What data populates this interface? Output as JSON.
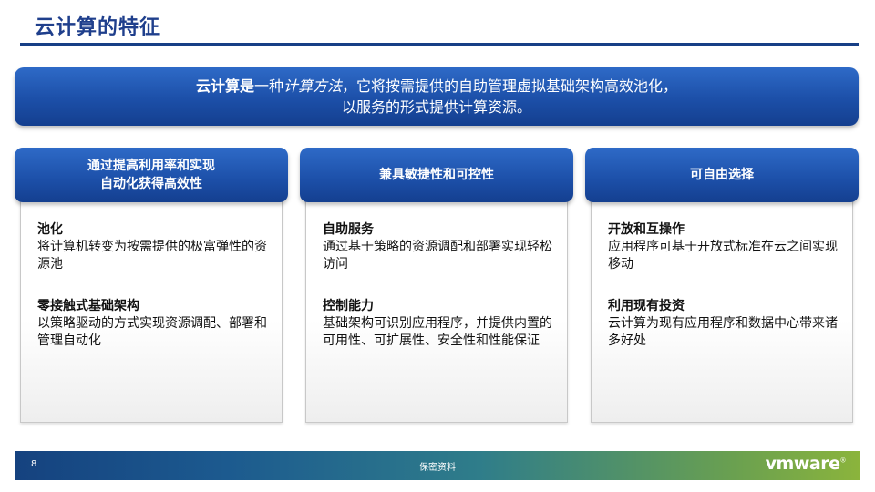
{
  "slide": {
    "title": "云计算的特征",
    "definition": {
      "bold_part": "云计算是",
      "plain_1": "一种",
      "italic_part": "计算方法",
      "plain_2": "，它将按需提供的自助管理虚拟基础架构高效池化，",
      "line_2": "以服务的形式提供计算资源。"
    },
    "columns": [
      {
        "header": "通过提高利用率和实现\n自动化获得高效性",
        "sections": [
          {
            "heading": "池化",
            "text": "将计算机转变为按需提供的极富弹性的资源池"
          },
          {
            "heading": "零接触式基础架构",
            "text": "以策略驱动的方式实现资源调配、部署和管理自动化"
          }
        ]
      },
      {
        "header": "兼具敏捷性和可控性",
        "sections": [
          {
            "heading": "自助服务",
            "text": "通过基于策略的资源调配和部署实现轻松访问"
          },
          {
            "heading": "控制能力",
            "text": "基础架构可识别应用程序，并提供内置的可用性、可扩展性、安全性和性能保证"
          }
        ]
      },
      {
        "header": "可自由选择",
        "sections": [
          {
            "heading": "开放和互操作",
            "text": "应用程序可基于开放式标准在云之间实现移动"
          },
          {
            "heading": "利用现有投资",
            "text": "云计算为现有应用程序和数据中心带来诸多好处"
          }
        ]
      }
    ],
    "footer": {
      "page_number": "8",
      "confidential": "保密资料",
      "logo_text": "vmware",
      "logo_mark": "®"
    },
    "colors": {
      "primary_blue": "#1c4fa8",
      "title_blue": "#1f3f8c"
    }
  }
}
